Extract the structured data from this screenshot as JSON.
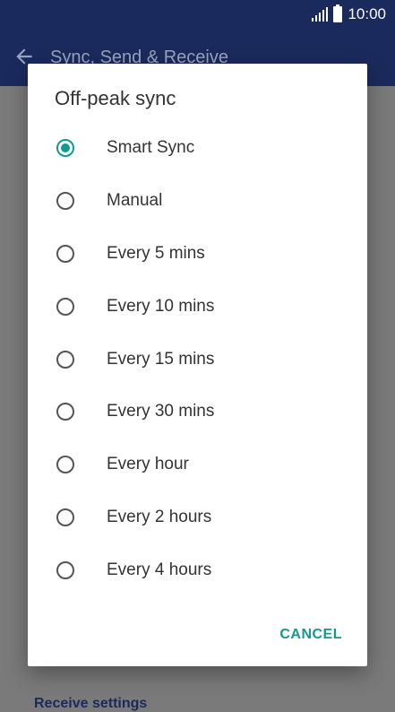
{
  "status_bar": {
    "time": "10:00"
  },
  "app_bar": {
    "title": "Sync, Send & Receive"
  },
  "content": {
    "partial_heading": "Receive settings"
  },
  "dialog": {
    "title": "Off-peak sync",
    "selected_index": 0,
    "options": [
      {
        "label": "Smart Sync",
        "selected": true
      },
      {
        "label": "Manual",
        "selected": false
      },
      {
        "label": "Every 5 mins",
        "selected": false
      },
      {
        "label": "Every 10 mins",
        "selected": false
      },
      {
        "label": "Every 15 mins",
        "selected": false
      },
      {
        "label": "Every 30 mins",
        "selected": false
      },
      {
        "label": "Every hour",
        "selected": false
      },
      {
        "label": "Every 2 hours",
        "selected": false
      },
      {
        "label": "Every 4 hours",
        "selected": false
      }
    ],
    "cancel_label": "CANCEL"
  },
  "colors": {
    "accent": "#0f9b8e",
    "app_bar": "#1a2a5c",
    "scrim": "#7a7a7a"
  }
}
